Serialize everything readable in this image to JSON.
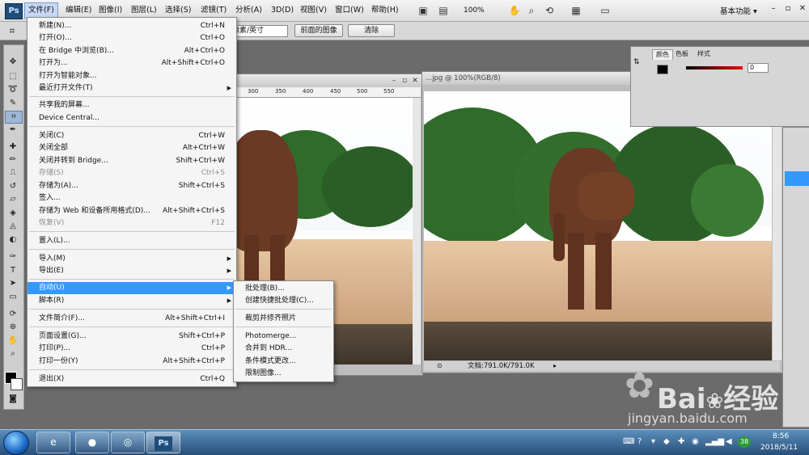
{
  "app": {
    "logo": "Ps"
  },
  "menubar": {
    "items": [
      "文件(F)",
      "编辑(E)",
      "图像(I)",
      "图层(L)",
      "选择(S)",
      "滤镜(T)",
      "分析(A)",
      "3D(D)",
      "视图(V)",
      "窗口(W)",
      "帮助(H)"
    ],
    "zoom": "100%",
    "workspace": "基本功能",
    "workspace_arrow": "▾",
    "window_buttons": [
      "–",
      "▫",
      "✕"
    ]
  },
  "optionsbar": {
    "unit_select": "像素/英寸",
    "front_image_button": "前面的图像",
    "clear_button": "清除"
  },
  "file_menu": {
    "items": [
      {
        "label": "新建(N)...",
        "shortcut": "Ctrl+N"
      },
      {
        "label": "打开(O)...",
        "shortcut": "Ctrl+O"
      },
      {
        "label": "在 Bridge 中浏览(B)...",
        "shortcut": "Alt+Ctrl+O"
      },
      {
        "label": "打开为...",
        "shortcut": "Alt+Shift+Ctrl+O"
      },
      {
        "label": "打开为智能对象...",
        "shortcut": ""
      },
      {
        "label": "最近打开文件(T)",
        "shortcut": ""
      },
      {
        "label": "共享我的屏幕...",
        "shortcut": ""
      },
      {
        "label": "Device Central...",
        "shortcut": ""
      },
      {
        "label": "关闭(C)",
        "shortcut": "Ctrl+W"
      },
      {
        "label": "关闭全部",
        "shortcut": "Alt+Ctrl+W"
      },
      {
        "label": "关闭并转到 Bridge...",
        "shortcut": "Shift+Ctrl+W"
      },
      {
        "label": "存储(S)",
        "shortcut": "Ctrl+S"
      },
      {
        "label": "存储为(A)...",
        "shortcut": "Shift+Ctrl+S"
      },
      {
        "label": "签入...",
        "shortcut": ""
      },
      {
        "label": "存储为 Web 和设备所用格式(D)...",
        "shortcut": "Alt+Shift+Ctrl+S"
      },
      {
        "label": "恢复(V)",
        "shortcut": "F12"
      },
      {
        "label": "置入(L)...",
        "shortcut": ""
      },
      {
        "label": "导入(M)",
        "shortcut": ""
      },
      {
        "label": "导出(E)",
        "shortcut": ""
      },
      {
        "label": "自动(U)",
        "shortcut": ""
      },
      {
        "label": "脚本(R)",
        "shortcut": ""
      },
      {
        "label": "文件简介(F)...",
        "shortcut": "Alt+Shift+Ctrl+I"
      },
      {
        "label": "页面设置(G)...",
        "shortcut": "Shift+Ctrl+P"
      },
      {
        "label": "打印(P)...",
        "shortcut": "Ctrl+P"
      },
      {
        "label": "打印一份(Y)",
        "shortcut": "Alt+Shift+Ctrl+P"
      },
      {
        "label": "退出(X)",
        "shortcut": "Ctrl+Q"
      }
    ],
    "submenu_arrow": "▶"
  },
  "automate_submenu": {
    "items": [
      "批处理(B)...",
      "创建快捷批处理(C)...",
      "裁剪并修齐照片",
      "Photomerge...",
      "合并到 HDR...",
      "条件模式更改...",
      "限制图像..."
    ]
  },
  "doc_left": {
    "ruler_ticks": [
      "300",
      "350",
      "400",
      "450",
      "500",
      "550"
    ],
    "window_buttons": [
      "–",
      "▫",
      "✕"
    ]
  },
  "doc_right": {
    "title": "...jpg @ 100%(RGB/8)",
    "status": "文档:791.0K/791.0K",
    "window_buttons": [
      "–",
      "▫",
      "✕"
    ]
  },
  "panels": {
    "tabs": [
      "颜色",
      "色板",
      "样式"
    ],
    "value": "0"
  },
  "watermark": {
    "brand": "Bai",
    "brand2": "经验",
    "sub": "jingyan.baidu.com"
  },
  "taskbar": {
    "ps_label": "Ps",
    "tray_badge": "38",
    "time": "8:56",
    "date": "2018/5/11"
  }
}
